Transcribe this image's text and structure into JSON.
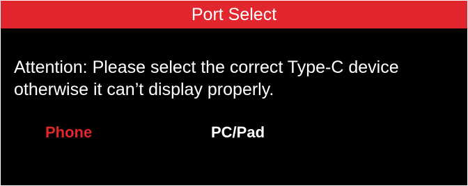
{
  "dialog": {
    "title": "Port Select",
    "message_lines": [
      "Attention: Please select the correct Type-C device",
      "otherwise it can’t display properly."
    ],
    "options": [
      {
        "label": "Phone",
        "selected": true
      },
      {
        "label": "PC/Pad",
        "selected": false
      }
    ]
  },
  "colors": {
    "title_bar": "#e1262d",
    "background": "#000000",
    "text": "#ffffff",
    "selected_option": "#e1262d",
    "unselected_option": "#ffffff"
  }
}
